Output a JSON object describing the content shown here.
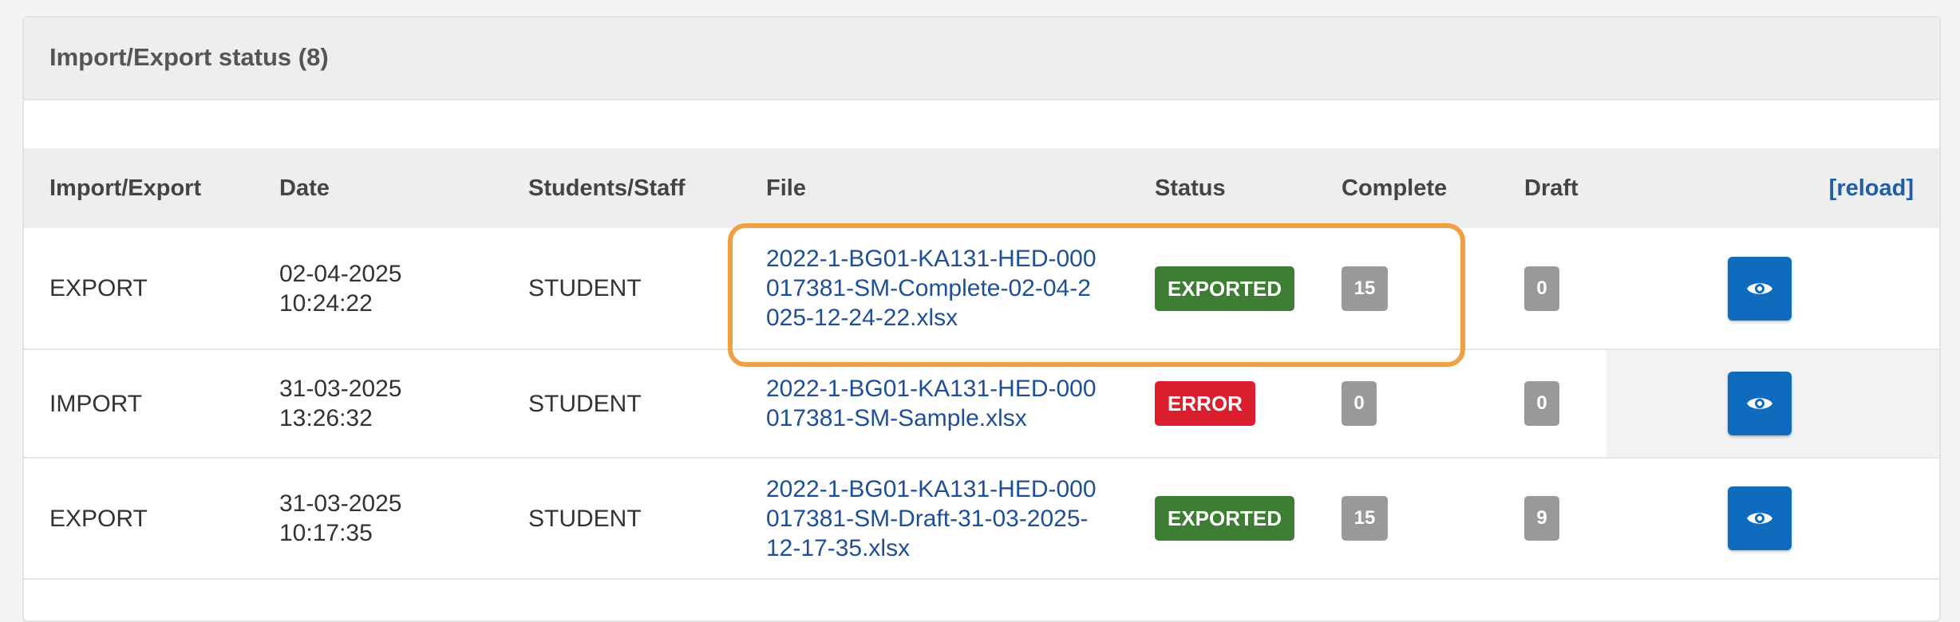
{
  "panel": {
    "title": "Import/Export status (8)"
  },
  "table": {
    "headers": {
      "import_export": "Import/Export",
      "date": "Date",
      "students_staff": "Students/Staff",
      "file": "File",
      "status": "Status",
      "complete": "Complete",
      "draft": "Draft",
      "reload": "[reload]"
    },
    "rows": [
      {
        "type": "EXPORT",
        "date": "02-04-2025",
        "time": "10:24:22",
        "who": "STUDENT",
        "file": "2022-1-BG01-KA131-HED-000017381-SM-Complete-02-04-2025-12-24-22.xlsx",
        "status": "EXPORTED",
        "status_color": "#3e7d34",
        "complete": "15",
        "draft": "0",
        "highlighted": true
      },
      {
        "type": "IMPORT",
        "date": "31-03-2025",
        "time": "13:26:32",
        "who": "STUDENT",
        "file": "2022-1-BG01-KA131-HED-000017381-SM-Sample.xlsx",
        "status": "ERROR",
        "status_color": "#dc1f2e",
        "complete": "0",
        "draft": "0",
        "highlighted": false
      },
      {
        "type": "EXPORT",
        "date": "31-03-2025",
        "time": "10:17:35",
        "who": "STUDENT",
        "file": "2022-1-BG01-KA131-HED-000017381-SM-Draft-31-03-2025-12-17-35.xlsx",
        "status": "EXPORTED",
        "status_color": "#3e7d34",
        "complete": "15",
        "draft": "9",
        "highlighted": false
      }
    ]
  },
  "colors": {
    "link": "#1f4f97",
    "view_button": "#0f6bbd",
    "highlight": "#f0a040",
    "badge_gray": "#999999"
  },
  "icons": {
    "view": "eye-icon"
  }
}
